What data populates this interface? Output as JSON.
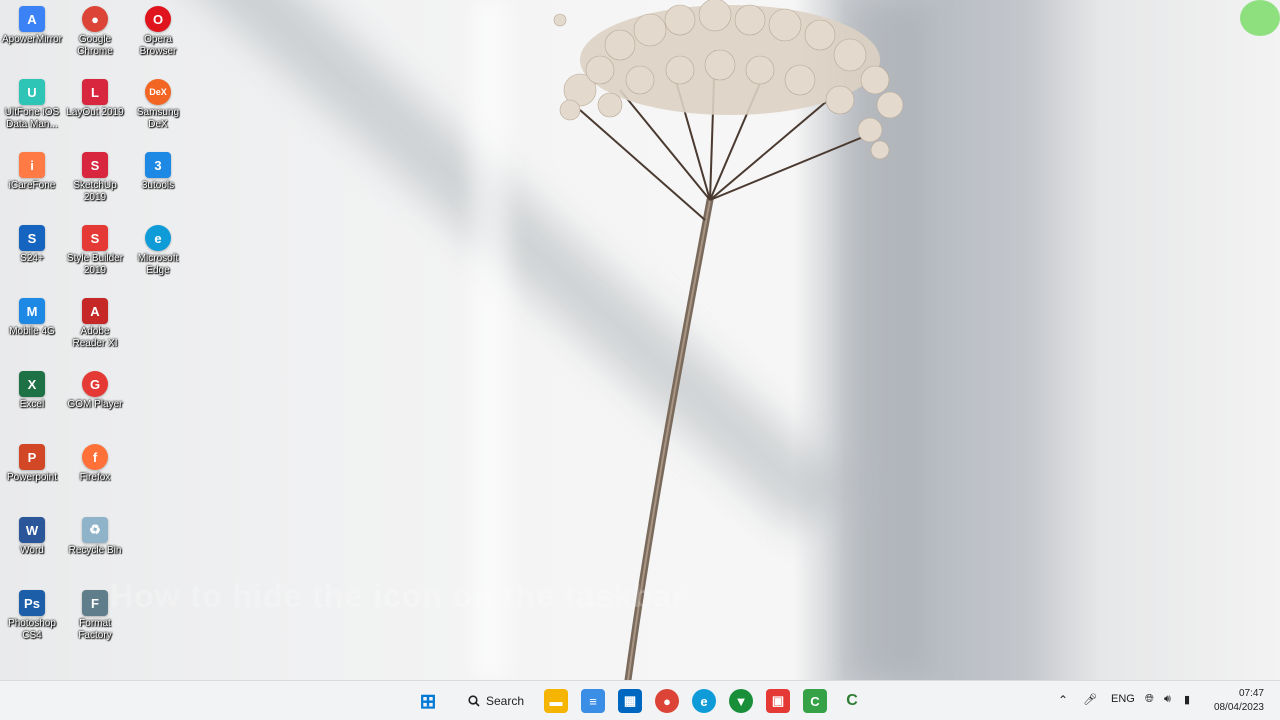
{
  "desktop": {
    "icons": [
      {
        "label": "ApowerMirror",
        "glyph": "A",
        "color": "#3b82f6"
      },
      {
        "label": "Google Chrome",
        "glyph": "●",
        "color": "#db4437"
      },
      {
        "label": "Opera Browser",
        "glyph": "O",
        "color": "#e0141c"
      },
      {
        "label": "UltFone iOS Data Man...",
        "glyph": "U",
        "color": "#2ec4b6"
      },
      {
        "label": "LayOut 2019",
        "glyph": "L",
        "color": "#d7263d"
      },
      {
        "label": "Samsung DeX",
        "glyph": "DeX",
        "color": "#f26522"
      },
      {
        "label": "iCareFone",
        "glyph": "i",
        "color": "#ff7a45"
      },
      {
        "label": "SketchUp 2019",
        "glyph": "S",
        "color": "#d7263d"
      },
      {
        "label": "3utools",
        "glyph": "3",
        "color": "#1e88e5"
      },
      {
        "label": "S24+",
        "glyph": "S",
        "color": "#1565c0"
      },
      {
        "label": "Style Builder 2019",
        "glyph": "S",
        "color": "#e53935"
      },
      {
        "label": "Microsoft Edge",
        "glyph": "e",
        "color": "#0f9bd7"
      },
      {
        "label": "Mobile 4G",
        "glyph": "M",
        "color": "#1e88e5"
      },
      {
        "label": "Adobe Reader XI",
        "glyph": "A",
        "color": "#c62828"
      },
      {
        "label": "Excel",
        "glyph": "X",
        "color": "#1e7145"
      },
      {
        "label": "GOM Player",
        "glyph": "G",
        "color": "#e53935"
      },
      {
        "label": "Powerpoint",
        "glyph": "P",
        "color": "#d24726"
      },
      {
        "label": "Firefox",
        "glyph": "f",
        "color": "#ff7139"
      },
      {
        "label": "Word",
        "glyph": "W",
        "color": "#2b579a"
      },
      {
        "label": "Recycle Bin",
        "glyph": "♻",
        "color": "#8fb3c9"
      },
      {
        "label": "Photoshop CS4",
        "glyph": "Ps",
        "color": "#1c5fa8"
      },
      {
        "label": "Format Factory",
        "glyph": "F",
        "color": "#607d8b"
      }
    ]
  },
  "overlay": {
    "subtitle": "How to hide the icon on the taskbar"
  },
  "taskbar": {
    "search_label": "Search",
    "apps": [
      {
        "name": "start",
        "glyph": "⊞",
        "color": "#0078d4"
      },
      {
        "name": "file-explorer",
        "glyph": "▬",
        "color": "#f4b400"
      },
      {
        "name": "notepad",
        "glyph": "≡",
        "color": "#3a8ee6"
      },
      {
        "name": "microsoft-store",
        "glyph": "▦",
        "color": "#0067c0"
      },
      {
        "name": "chrome",
        "glyph": "●",
        "color": "#db4437"
      },
      {
        "name": "edge",
        "glyph": "e",
        "color": "#0f9bd7"
      },
      {
        "name": "vpn",
        "glyph": "▼",
        "color": "#1a8f3a"
      },
      {
        "name": "media",
        "glyph": "▣",
        "color": "#e53935"
      },
      {
        "name": "camtasia",
        "glyph": "C",
        "color": "#35a248"
      },
      {
        "name": "camtasia-recorder",
        "glyph": "C",
        "color": "#2e7d32"
      }
    ],
    "tray": {
      "language": "ENG",
      "time": "07:47",
      "date": "08/04/2023"
    }
  }
}
